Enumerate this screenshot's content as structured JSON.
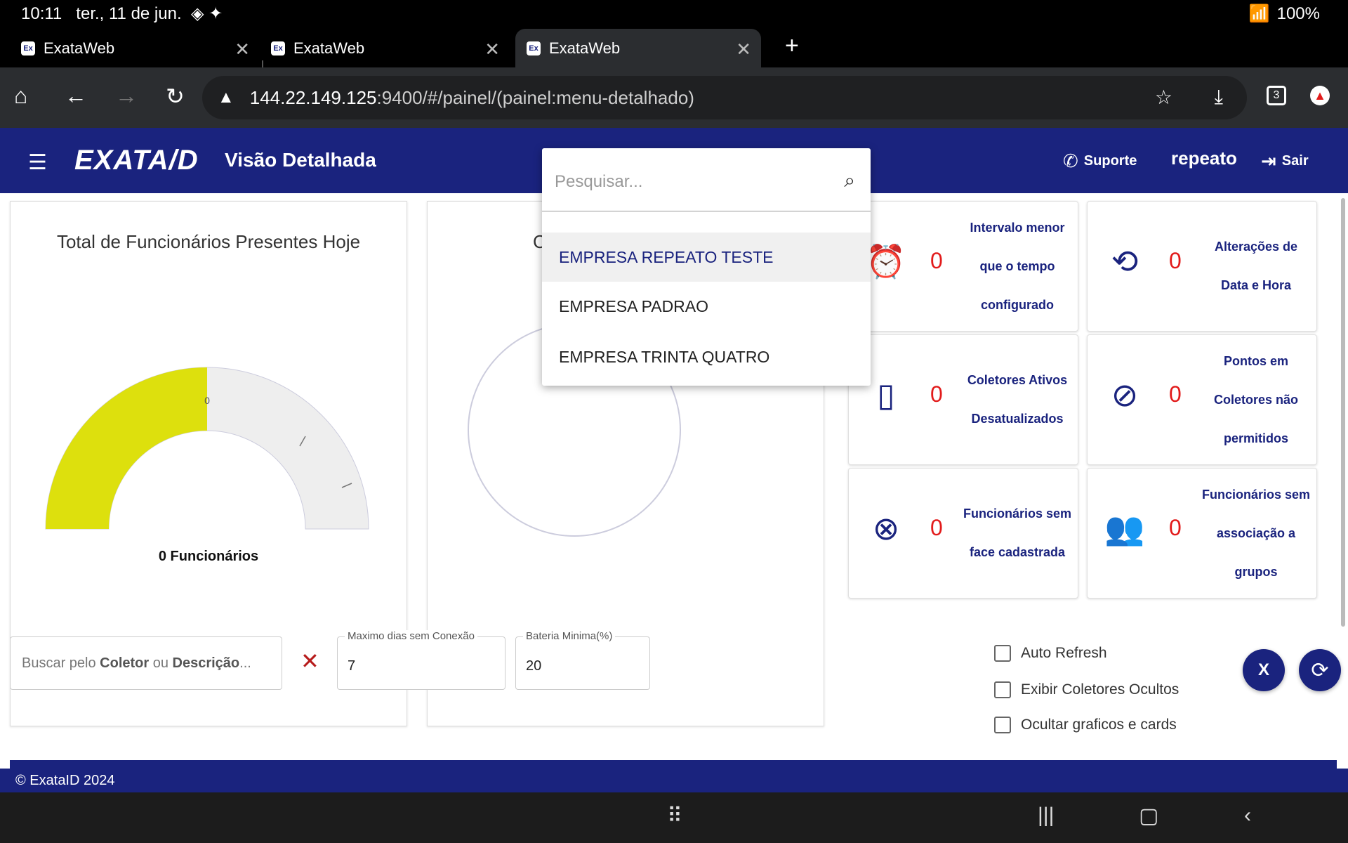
{
  "status_bar": {
    "time": "10:11",
    "date": "ter., 11 de jun.",
    "battery": "100%"
  },
  "browser": {
    "tabs": [
      {
        "title": "ExataWeb",
        "favicon": "Ex"
      },
      {
        "title": "ExataWeb",
        "favicon": "Ex"
      },
      {
        "title": "ExataWeb",
        "favicon": "Ex"
      }
    ],
    "url_host": "144.22.149.125",
    "url_path": ":9400/#/painel/(painel:menu-detalhado)",
    "tab_count": "3"
  },
  "header": {
    "logo": "EXATA/D",
    "title": "Visão Detalhada",
    "support": "Suporte",
    "username": "repeato",
    "logout": "Sair"
  },
  "gauge_panel": {
    "title": "Total de Funcionários Presentes Hoje",
    "value_label": "0",
    "footer": "0 Funcionários",
    "fill_fraction": 0.5
  },
  "second_panel": {
    "title_initial": "C"
  },
  "dropdown": {
    "placeholder": "Pesquisar...",
    "items": [
      "EMPRESA REPEATO TESTE",
      "EMPRESA PADRAO",
      "EMPRESA TRINTA QUATRO"
    ]
  },
  "cards": [
    {
      "count": "0",
      "label": "Intervalo menor que o tempo configurado",
      "icon": "alarm-off-icon"
    },
    {
      "count": "0",
      "label": "Alterações de Data e Hora",
      "icon": "history-icon"
    },
    {
      "count": "0",
      "label": "Coletores Ativos Desatualizados",
      "icon": "tablet-icon"
    },
    {
      "count": "0",
      "label": "Pontos em Coletores não permitidos",
      "icon": "person-off-icon"
    },
    {
      "count": "0",
      "label": "Funcionários sem face cadastrada",
      "icon": "face-off-icon"
    },
    {
      "count": "0",
      "label": "Funcionários sem associação a grupos",
      "icon": "groups-icon"
    }
  ],
  "filters": {
    "search_placeholder_a": "Buscar pelo ",
    "search_placeholder_b": "Coletor",
    "search_placeholder_c": " ou ",
    "search_placeholder_d": "Descrição",
    "search_placeholder_e": "...",
    "max_days_label": "Maximo dias sem Conexão",
    "max_days_value": "7",
    "battery_label": "Bateria Minima(%)",
    "battery_value": "20",
    "checkboxes": [
      "Auto Refresh",
      "Exibir Coletores Ocultos",
      "Ocultar graficos e cards"
    ]
  },
  "footer": {
    "text": "© ExataID 2024"
  },
  "colors": {
    "primary": "#1a237e",
    "gauge_fill": "#dde00d",
    "count_red": "#e21b1b"
  }
}
